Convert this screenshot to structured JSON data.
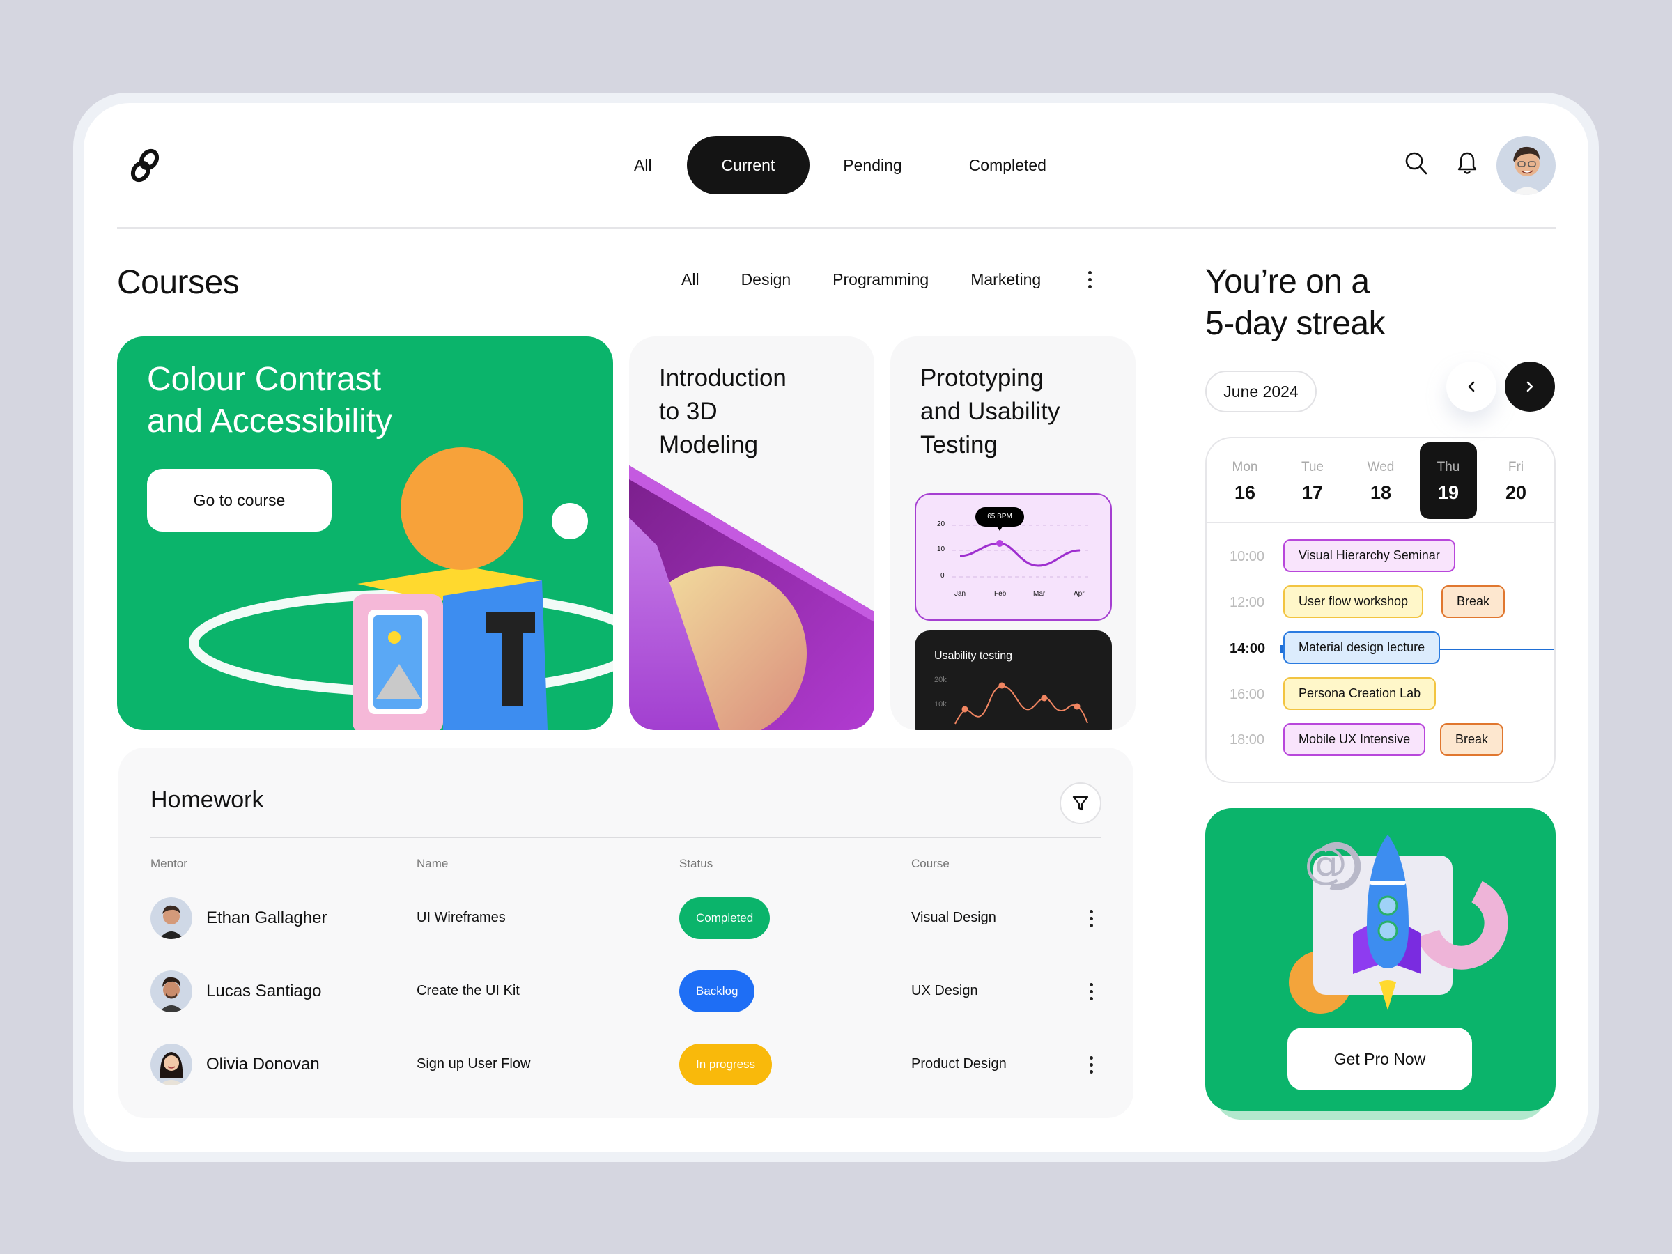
{
  "header": {
    "tabs": [
      {
        "label": "All",
        "active": false
      },
      {
        "label": "Current",
        "active": true
      },
      {
        "label": "Pending",
        "active": false
      },
      {
        "label": "Completed",
        "active": false
      }
    ],
    "icons": [
      "search-icon",
      "bell-icon"
    ]
  },
  "courses": {
    "title": "Courses",
    "categories": [
      "All",
      "Design",
      "Programming",
      "Marketing"
    ],
    "cards": [
      {
        "title_line1": "Colour Contrast",
        "title_line2": "and Accessibility",
        "button": "Go to course",
        "color": "#0BB46B"
      },
      {
        "title_line1": "Introduction",
        "title_line2": "to 3D",
        "title_line3": "Modeling"
      },
      {
        "title_line1": "Prototyping",
        "title_line2": "and Usability",
        "title_line3": "Testing"
      }
    ],
    "bpm_chart": {
      "tooltip": "65 BPM",
      "y_ticks": [
        "20",
        "10",
        "0"
      ],
      "x_ticks": [
        "Jan",
        "Feb",
        "Mar",
        "Apr"
      ]
    },
    "usability_chart": {
      "title": "Usability testing",
      "y_ticks": [
        "20k",
        "10k"
      ]
    }
  },
  "homework": {
    "title": "Homework",
    "columns": [
      "Mentor",
      "Name",
      "Status",
      "Course"
    ],
    "rows": [
      {
        "mentor": "Ethan Gallagher",
        "name": "UI Wireframes",
        "status": "Completed",
        "status_color": "#0BB46B",
        "course": "Visual Design"
      },
      {
        "mentor": "Lucas Santiago",
        "name": "Create the UI Kit",
        "status": "Backlog",
        "status_color": "#1E6EF5",
        "course": "UX Design"
      },
      {
        "mentor": "Olivia Donovan",
        "name": "Sign up User Flow",
        "status": "In progress",
        "status_color": "#F9B90B",
        "course": "Product Design"
      }
    ]
  },
  "streak": {
    "line1": "You’re on a",
    "line2": "5-day streak"
  },
  "calendar": {
    "month": "June 2024",
    "days": [
      {
        "name": "Mon",
        "num": "16",
        "active": false
      },
      {
        "name": "Tue",
        "num": "17",
        "active": false
      },
      {
        "name": "Wed",
        "num": "18",
        "active": false
      },
      {
        "name": "Thu",
        "num": "19",
        "active": true
      },
      {
        "name": "Fri",
        "num": "20",
        "active": false
      }
    ],
    "times": [
      "10:00",
      "12:00",
      "14:00",
      "16:00",
      "18:00"
    ],
    "current_time": "14:00",
    "events": [
      {
        "label": "Visual Hierarchy Seminar",
        "slot": 0,
        "kind": "purple"
      },
      {
        "label": "User flow workshop",
        "slot": 1,
        "kind": "yellow"
      },
      {
        "label": "Break",
        "slot": 1,
        "kind": "orange"
      },
      {
        "label": "Material design lecture",
        "slot": 2,
        "kind": "blue"
      },
      {
        "label": "Persona Creation Lab",
        "slot": 3,
        "kind": "yellow"
      },
      {
        "label": "Mobile UX Intensive",
        "slot": 4,
        "kind": "purple"
      },
      {
        "label": "Break",
        "slot": 4,
        "kind": "orange"
      }
    ]
  },
  "promo": {
    "button": "Get Pro Now"
  },
  "colors": {
    "accent_green": "#0BB46B",
    "dark": "#141414",
    "purple": "#A53FD1",
    "blue": "#1E6EF5",
    "yellow": "#F9B90B"
  }
}
